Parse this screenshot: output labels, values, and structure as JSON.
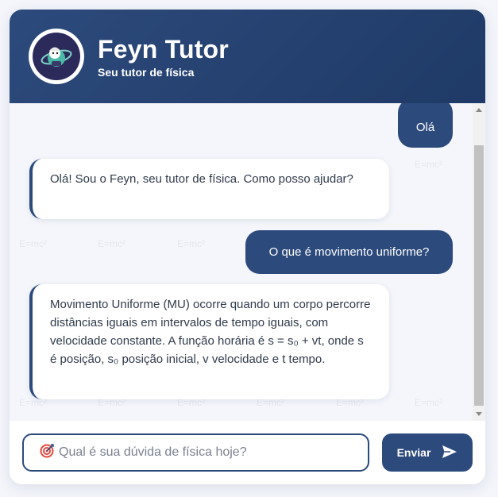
{
  "header": {
    "title": "Feyn Tutor",
    "subtitle": "Seu tutor de física",
    "avatar_icon": "scientist-avatar-icon"
  },
  "watermark": "E=mc²",
  "messages": [
    {
      "role": "user",
      "text": "Olá"
    },
    {
      "role": "bot",
      "text": "Olá! Sou o Feyn, seu tutor de física. Como posso ajudar?"
    },
    {
      "role": "user",
      "text": "O que é movimento uniforme?"
    },
    {
      "role": "bot",
      "text": "Movimento Uniforme (MU) ocorre quando um corpo percorre distâncias iguais em intervalos de tempo iguais, com velocidade constante. A função horária é s = s₀ + vt, onde s é posição, s₀ posição inicial, v velocidade e t tempo."
    }
  ],
  "input": {
    "placeholder": "Qual é sua dúvida de física hoje?",
    "value": "",
    "icon": "target-icon"
  },
  "send_button": {
    "label": "Enviar",
    "icon": "send-icon"
  },
  "colors": {
    "primary": "#2c4a7c",
    "chat_background": "#f4f6fb",
    "bot_bubble": "#ffffff"
  }
}
